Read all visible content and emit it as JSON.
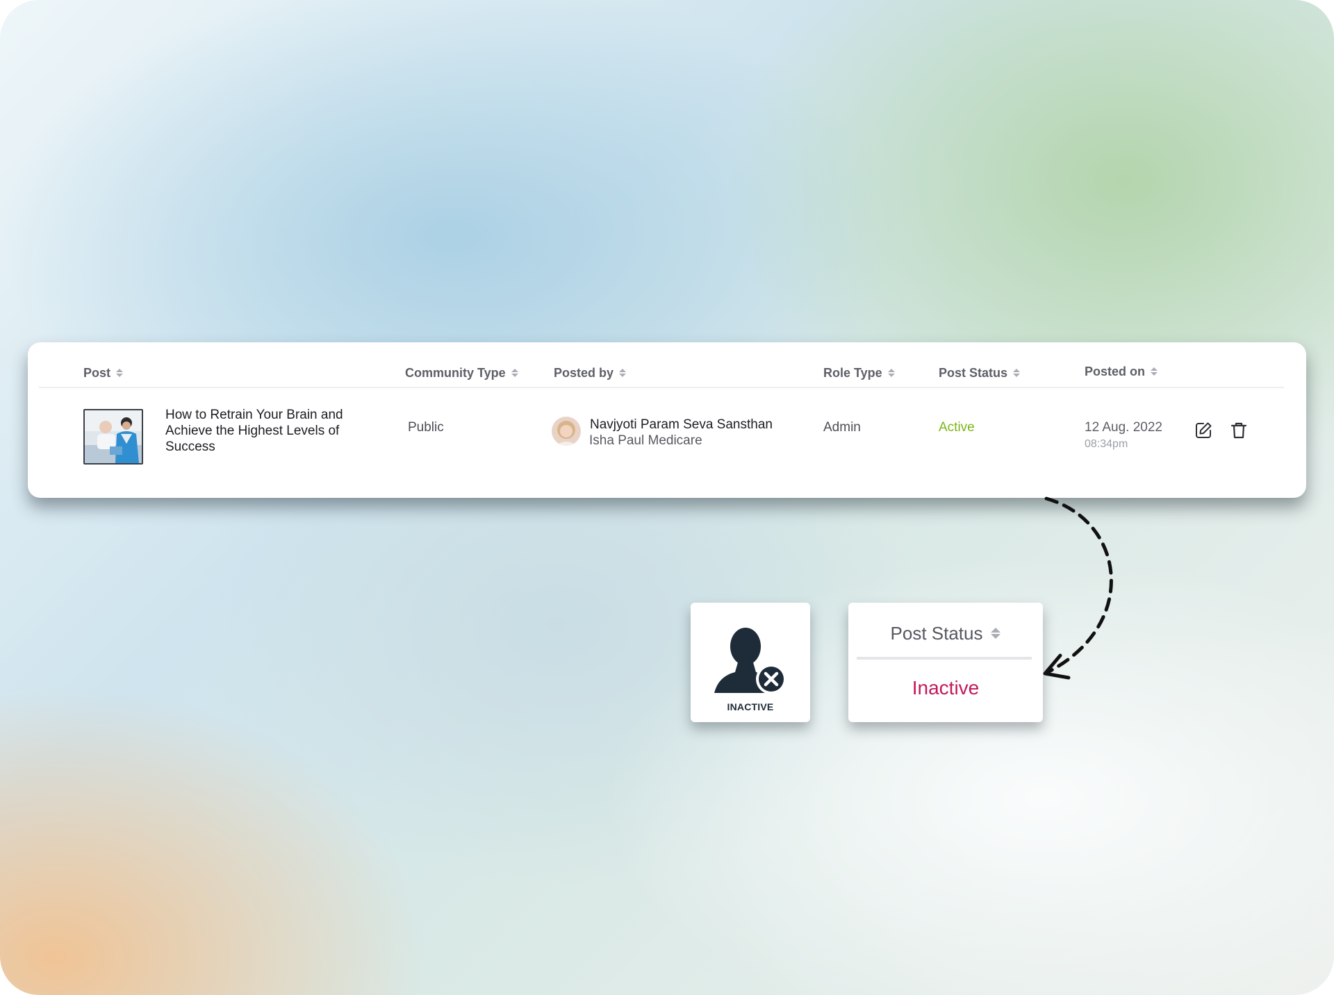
{
  "table": {
    "columns": [
      {
        "key": "post",
        "label": "Post"
      },
      {
        "key": "community_type",
        "label": "Community Type"
      },
      {
        "key": "posted_by",
        "label": "Posted by"
      },
      {
        "key": "role_type",
        "label": "Role Type"
      },
      {
        "key": "post_status",
        "label": "Post Status"
      },
      {
        "key": "posted_on",
        "label": "Posted on"
      }
    ],
    "rows": [
      {
        "post_title": "How to Retrain Your Brain and Achieve the Highest Levels of Success",
        "community_type": "Public",
        "posted_by_name": "Navjyoti Param Seva Sansthan",
        "posted_by_org": "Isha Paul Medicare",
        "role_type": "Admin",
        "post_status": "Active",
        "posted_date": "12 Aug. 2022",
        "posted_time": "08:34pm",
        "actions": {
          "edit_icon": "edit-pencil-icon",
          "delete_icon": "trash-icon"
        }
      }
    ]
  },
  "inactive_badge": {
    "caption": "INACTIVE",
    "icon": "user-x-icon"
  },
  "status_popup": {
    "header": "Post Status",
    "value": "Inactive"
  },
  "colors": {
    "active": "#7cb518",
    "inactive": "#c2185b",
    "header_text": "#5c5f66",
    "icon_dark": "#1e2b38"
  }
}
